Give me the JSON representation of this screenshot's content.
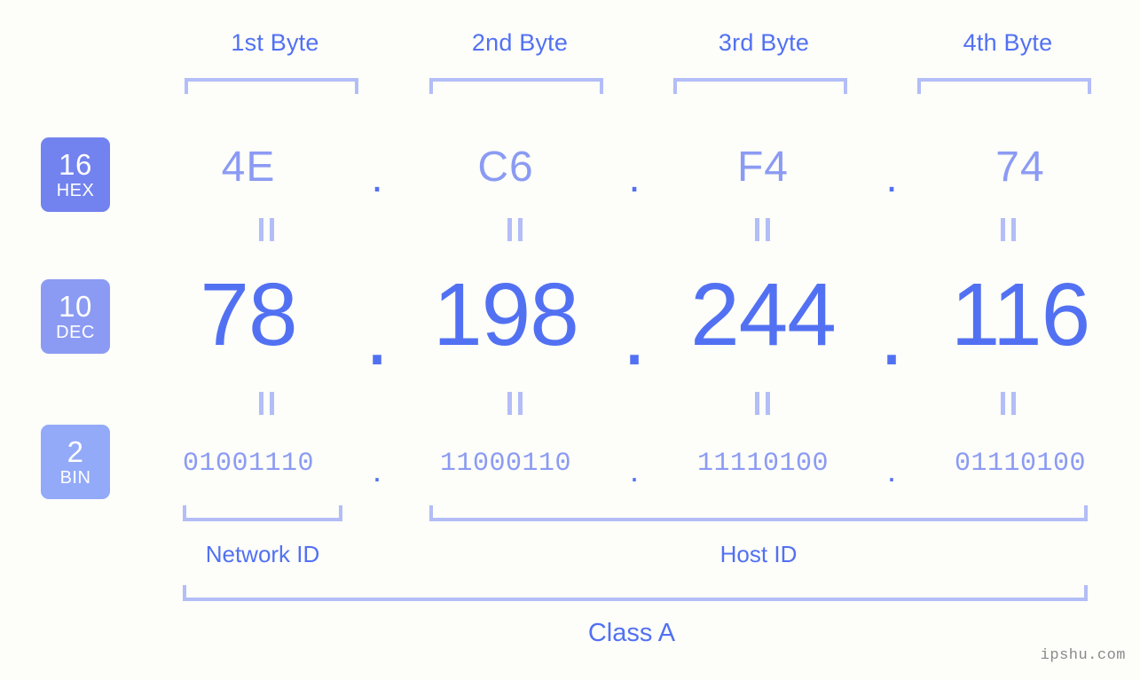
{
  "ip": {
    "decimal": "78.198.244.116",
    "class": "Class A"
  },
  "header": {
    "byte_labels": [
      "1st Byte",
      "2nd Byte",
      "3rd Byte",
      "4th Byte"
    ]
  },
  "badges": [
    {
      "base": "16",
      "name": "HEX",
      "color": "#7282ee"
    },
    {
      "base": "10",
      "name": "DEC",
      "color": "#8b9bf3"
    },
    {
      "base": "2",
      "name": "BIN",
      "color": "#93aaf9"
    }
  ],
  "rows": {
    "hex": {
      "values": [
        "4E",
        "C6",
        "F4",
        "74"
      ],
      "separator": "."
    },
    "dec": {
      "values": [
        "78",
        "198",
        "244",
        "116"
      ],
      "separator": "."
    },
    "bin": {
      "values": [
        "01001110",
        "11000110",
        "11110100",
        "01110100"
      ],
      "separator": "."
    }
  },
  "equals_symbol": "=",
  "footer": {
    "network_id_label": "Network ID",
    "host_id_label": "Host ID",
    "class_label": "Class A",
    "watermark": "ipshu.com"
  },
  "colors": {
    "background": "#fdfdfa",
    "accent_strong": "#5271f2",
    "accent_mid": "#8b9bf3",
    "accent_light": "#b3bdf7"
  }
}
